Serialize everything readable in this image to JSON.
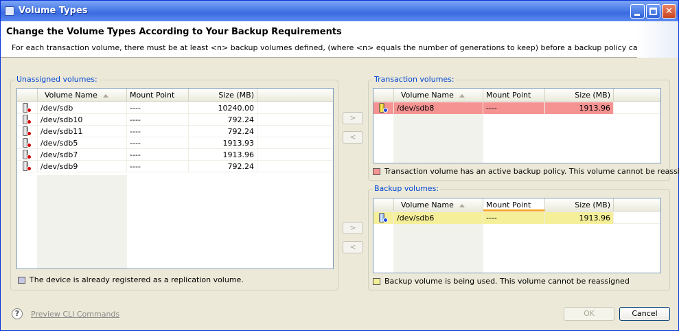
{
  "window": {
    "title": "Volume Types"
  },
  "header": {
    "title": "Change the Volume Types According to Your Backup Requirements",
    "description": "For each transaction volume, there must be at least <n> backup volumes defined, (where <n> equals the number of generations to keep) before a backup policy can be set."
  },
  "unassigned": {
    "label": "Unassigned volumes:",
    "columns": [
      "Volume Name",
      "Mount Point",
      "Size (MB)"
    ],
    "rows": [
      {
        "name": "/dev/sdb",
        "mount": "----",
        "size": "10240.00"
      },
      {
        "name": "/dev/sdb10",
        "mount": "----",
        "size": "792.24"
      },
      {
        "name": "/dev/sdb11",
        "mount": "----",
        "size": "792.24"
      },
      {
        "name": "/dev/sdb5",
        "mount": "----",
        "size": "1913.93"
      },
      {
        "name": "/dev/sdb7",
        "mount": "----",
        "size": "1913.96"
      },
      {
        "name": "/dev/sdb9",
        "mount": "----",
        "size": "792.24"
      }
    ],
    "legend": "The device is already registered as a replication volume.",
    "legend_color": "#c8c8e6"
  },
  "transaction": {
    "label": "Transaction volumes:",
    "columns": [
      "Volume Name",
      "Mount Point",
      "Size (MB)"
    ],
    "rows": [
      {
        "name": "/dev/sdb8",
        "mount": "----",
        "size": "1913.96"
      }
    ],
    "legend": "Transaction volume has an active backup policy.  This volume cannot be reassigned",
    "legend_color": "#f59393"
  },
  "backup": {
    "label": "Backup volumes:",
    "columns": [
      "Volume Name",
      "Mount Point",
      "Size (MB)"
    ],
    "rows": [
      {
        "name": "/dev/sdb6",
        "mount": "----",
        "size": "1913.96"
      }
    ],
    "legend": "Backup volume is being used.  This volume cannot be reassigned",
    "legend_color": "#f5ef9a"
  },
  "arrows": {
    "right": ">",
    "left": "<"
  },
  "footer": {
    "help": "?",
    "preview_link": "Preview CLI Commands",
    "ok": "OK",
    "cancel": "Cancel"
  },
  "icons": {
    "volume": "disk-volume-icon",
    "help": "help-icon",
    "minimize": "minimize-icon",
    "maximize": "maximize-icon",
    "close": "close-icon"
  }
}
